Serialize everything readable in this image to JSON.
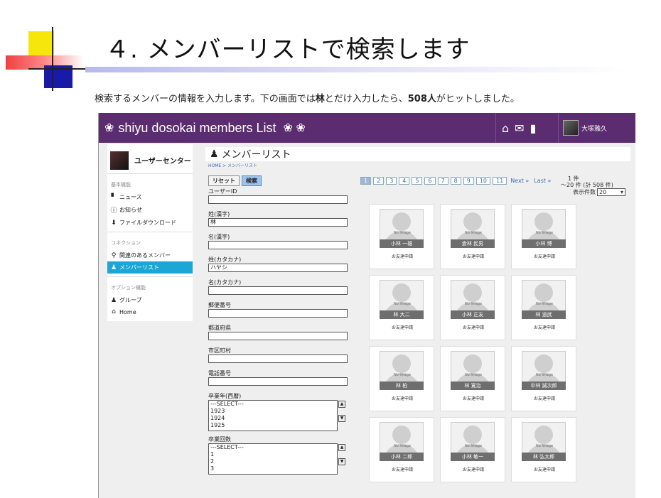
{
  "slide": {
    "title": "４. メンバーリストで検索します",
    "subtitle_pre": "検索するメンバーの情報を入力します。下の画面では",
    "subtitle_b1": "林",
    "subtitle_mid": "とだけ入力したら、",
    "subtitle_b2": "508人",
    "subtitle_post": "がヒットしました。"
  },
  "topbar": {
    "brand": "shiyu dosokai members List",
    "user_name": "大塚雅久",
    "icons": [
      "home-icon",
      "mail-icon",
      "alert-icon"
    ]
  },
  "sidebar": {
    "user_center": "ユーザーセンター",
    "sections": [
      {
        "label": "基本機能",
        "items": [
          {
            "label": "ニュース",
            "icon": "document-icon"
          },
          {
            "label": "お知らせ",
            "icon": "info-icon"
          },
          {
            "label": "ファイルダウンロード",
            "icon": "download-icon"
          }
        ]
      },
      {
        "label": "コネクション",
        "items": [
          {
            "label": "関連のあるメンバー",
            "icon": "search-icon"
          },
          {
            "label": "メンバーリスト",
            "icon": "person-icon"
          }
        ]
      },
      {
        "label": "オプション機能",
        "items": [
          {
            "label": "グループ",
            "icon": "group-icon"
          },
          {
            "label": "Home",
            "icon": "home-icon"
          }
        ]
      }
    ]
  },
  "main": {
    "title": "メンバーリスト",
    "breadcrumb": "HOME > メンバーリスト"
  },
  "form": {
    "reset": "リセット",
    "search": "検索",
    "fields": [
      {
        "label": "ユーザーID",
        "value": ""
      },
      {
        "label": "姓(漢字)",
        "value": "林"
      },
      {
        "label": "名(漢字)",
        "value": ""
      },
      {
        "label": "姓(カタカナ)",
        "value": "ハヤシ"
      },
      {
        "label": "名(カタカナ)",
        "value": ""
      },
      {
        "label": "郵便番号",
        "value": ""
      },
      {
        "label": "都道府県",
        "value": ""
      },
      {
        "label": "市区町村",
        "value": ""
      },
      {
        "label": "電話番号",
        "value": ""
      }
    ],
    "grad_year": {
      "label": "卒業年(西暦)",
      "options": [
        "---SELECT---",
        "1923",
        "1924",
        "1925"
      ]
    },
    "grad_class": {
      "label": "卒業回数",
      "options": [
        "---SELECT---",
        "1",
        "2",
        "3"
      ]
    }
  },
  "pager": {
    "pages": [
      "1",
      "2",
      "3",
      "4",
      "5",
      "6",
      "7",
      "8",
      "9",
      "10",
      "11"
    ],
    "current": "1",
    "next": "Next »",
    "last": "Last »",
    "count_line1": "1 件",
    "count_line2": "～20 件 (計 508 件)",
    "per_page_label": "表示件数",
    "per_page_value": "20"
  },
  "members": {
    "no_image": "No Image",
    "friend_request": "お友達申請",
    "names": [
      "小林 一雄",
      "倉林 民男",
      "小林 博",
      "林 大二",
      "小林 正友",
      "林 道武",
      "林 柏",
      "林 寛治",
      "中林 誠次郎",
      "小林 二郎",
      "小林 敏一",
      "林 弘太郎"
    ]
  }
}
